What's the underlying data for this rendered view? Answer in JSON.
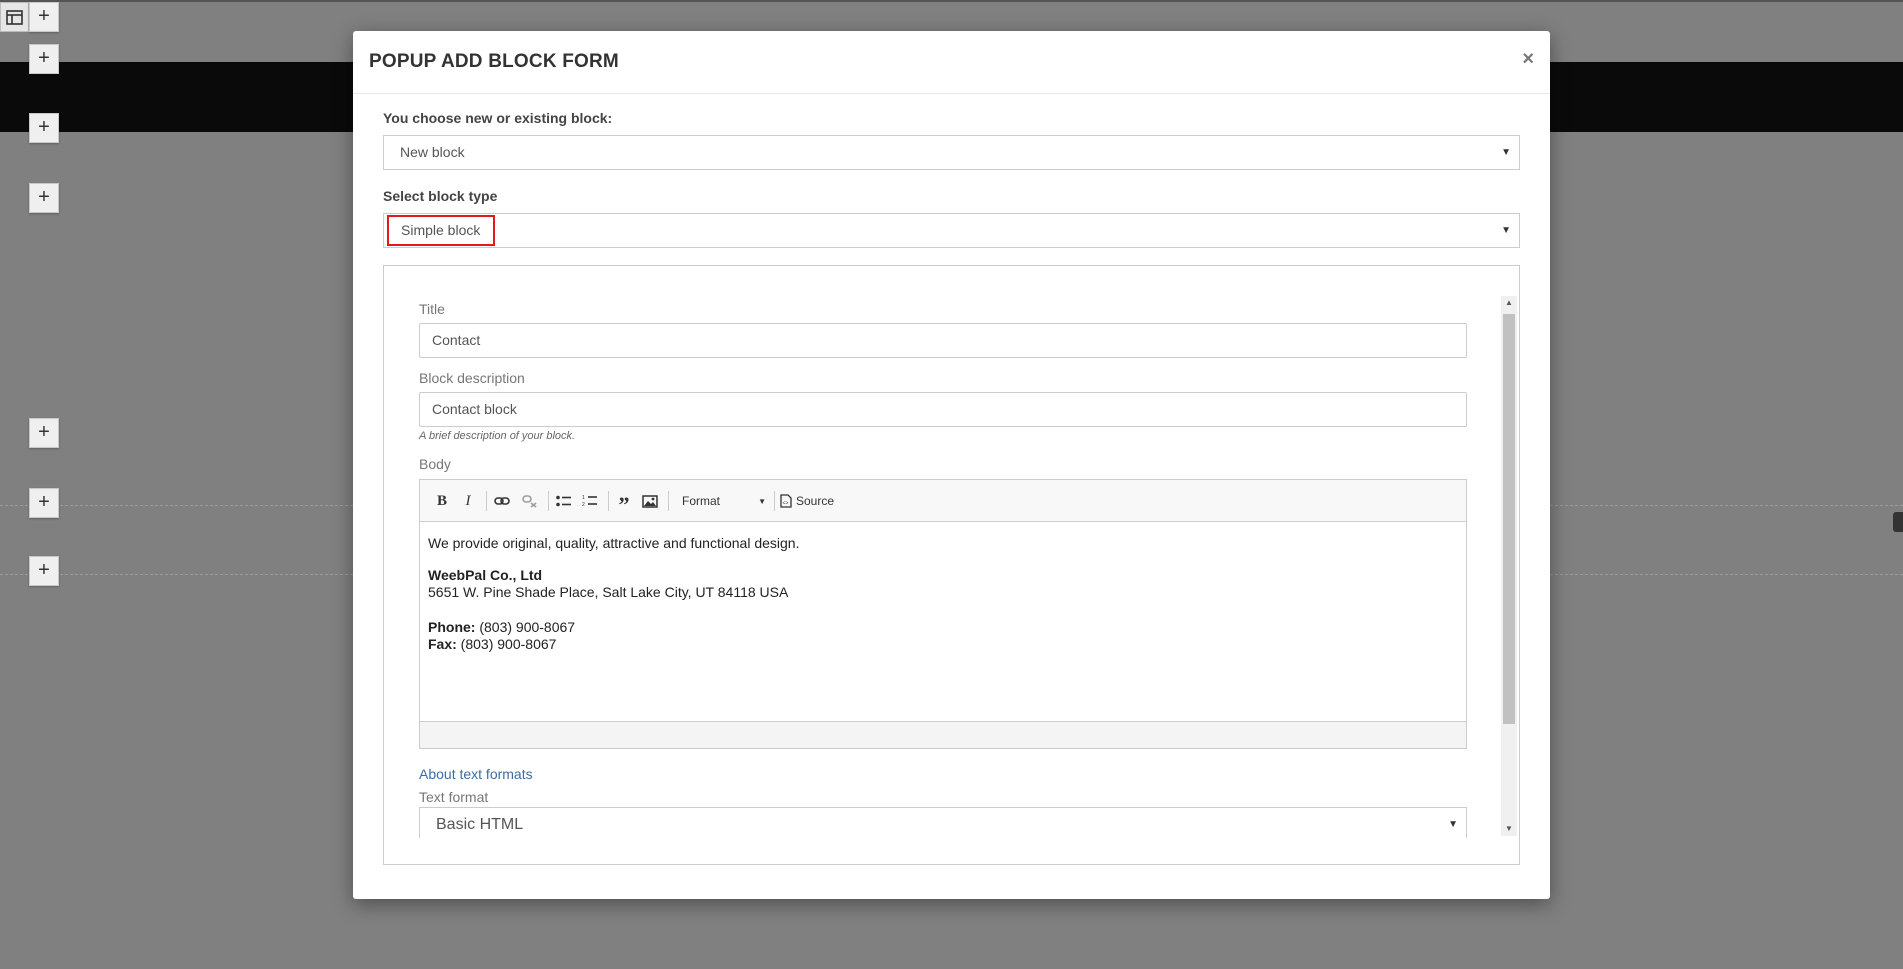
{
  "modal": {
    "title": "POPUP ADD BLOCK FORM",
    "close": "×",
    "choose_label": "You choose new or existing block:",
    "choose_value": "New block",
    "type_label": "Select block type",
    "type_value": "Simple block",
    "title_label": "Title",
    "title_value": "Contact",
    "desc_label": "Block description",
    "desc_value": "Contact block",
    "desc_help": "A brief description of your block.",
    "body_label": "Body",
    "toolbar": {
      "bold": "B",
      "italic": "I",
      "format": "Format",
      "source": "Source"
    },
    "body": {
      "line1": "We provide original, quality, attractive and functional design.",
      "company": "WeebPal Co., Ltd",
      "address": "5651 W. Pine Shade Place, Salt Lake City, UT 84118 USA",
      "phone_label": "Phone:",
      "phone_value": " (803) 900-8067",
      "fax_label": "Fax:",
      "fax_value": " (803) 900-8067"
    },
    "about_formats": "About text formats",
    "text_format_label": "Text format",
    "text_format_value": "Basic HTML"
  },
  "background": {
    "plus": "+"
  }
}
